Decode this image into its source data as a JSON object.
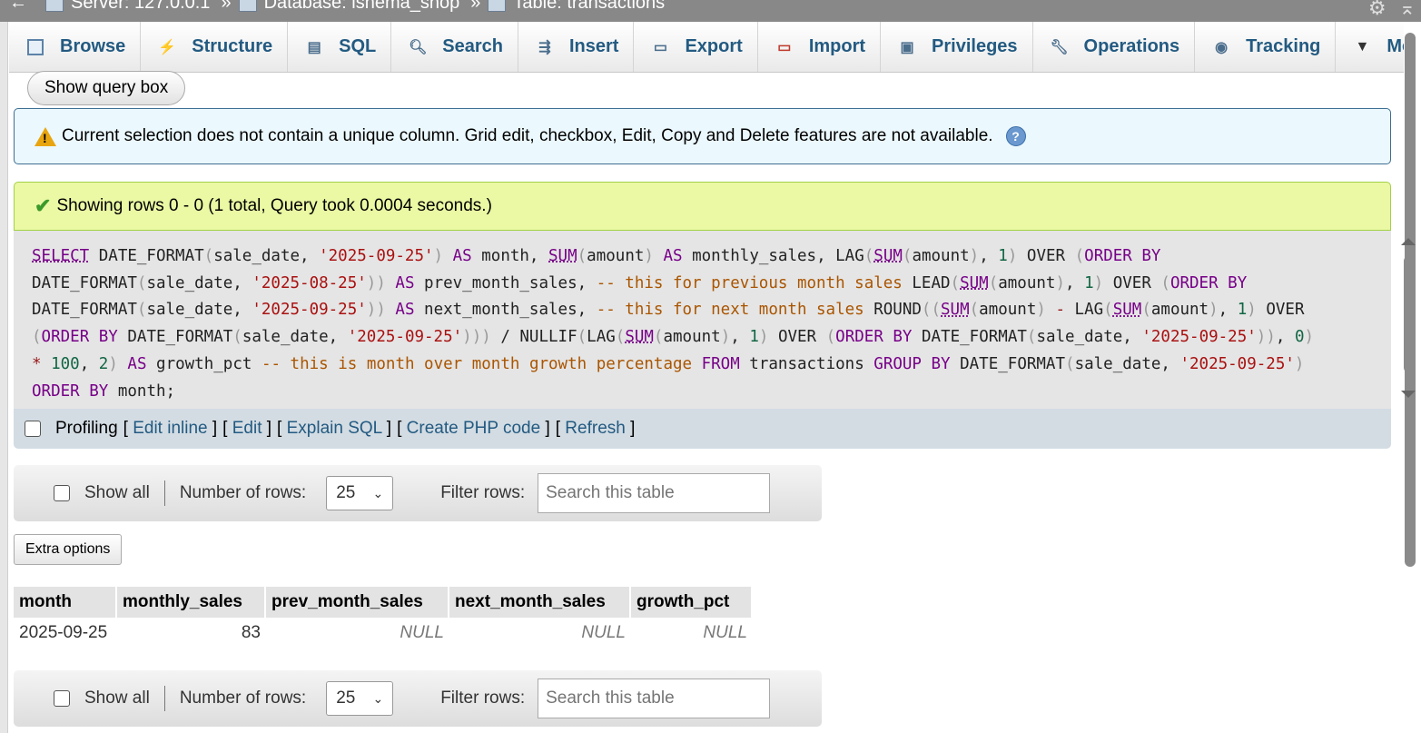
{
  "breadcrumb": {
    "server": "Server: 127.0.0.1",
    "database": "Database: ishema_shop",
    "table": "Table: transactions",
    "separator": "»"
  },
  "tabs": [
    {
      "label": "Browse",
      "icon": "browse-icon"
    },
    {
      "label": "Structure",
      "icon": "structure-icon"
    },
    {
      "label": "SQL",
      "icon": "sql-icon"
    },
    {
      "label": "Search",
      "icon": "search-icon"
    },
    {
      "label": "Insert",
      "icon": "insert-icon"
    },
    {
      "label": "Export",
      "icon": "export-icon"
    },
    {
      "label": "Import",
      "icon": "import-icon"
    },
    {
      "label": "Privileges",
      "icon": "privileges-icon"
    },
    {
      "label": "Operations",
      "icon": "wrench-icon"
    },
    {
      "label": "Tracking",
      "icon": "eye-icon"
    },
    {
      "label": "More",
      "icon": "caret-down-icon"
    }
  ],
  "show_query_box": "Show query box",
  "notice": "Current selection does not contain a unique column. Grid edit, checkbox, Edit, Copy and Delete features are not available.",
  "success": "Showing rows 0 - 0 (1 total, Query took 0.0004 seconds.)",
  "sql_query": "SELECT DATE_FORMAT(sale_date, '2025-09-25') AS month, SUM(amount) AS monthly_sales, LAG(SUM(amount), 1) OVER (ORDER BY DATE_FORMAT(sale_date, '2025-08-25')) AS prev_month_sales, -- this for previous month sales LEAD(SUM(amount), 1) OVER (ORDER BY DATE_FORMAT(sale_date, '2025-09-25')) AS next_month_sales, -- this for next month sales ROUND((SUM(amount) - LAG(SUM(amount), 1) OVER (ORDER BY DATE_FORMAT(sale_date, '2025-09-25'))) / NULLIF(LAG(SUM(amount), 1) OVER (ORDER BY DATE_FORMAT(sale_date, '2025-09-25')), 0) * 100, 2) AS growth_pct -- this is month over month growth percentage FROM transactions GROUP BY DATE_FORMAT(sale_date, '2025-09-25') ORDER BY month;",
  "profiling": {
    "label": "Profiling",
    "links": [
      "Edit inline",
      "Edit",
      "Explain SQL",
      "Create PHP code",
      "Refresh"
    ]
  },
  "nav": {
    "show_all": "Show all",
    "number_of_rows_label": "Number of rows:",
    "number_of_rows_value": "25",
    "filter_label": "Filter rows:",
    "filter_placeholder": "Search this table"
  },
  "extra_options": "Extra options",
  "results": {
    "columns": [
      "month",
      "monthly_sales",
      "prev_month_sales",
      "next_month_sales",
      "growth_pct"
    ],
    "rows": [
      [
        "2025-09-25",
        "83",
        "NULL",
        "NULL",
        "NULL"
      ]
    ]
  },
  "colors": {
    "link": "#235a81",
    "notice_bg": "#ebf8fd",
    "success_bg": "#ebf8a4"
  }
}
